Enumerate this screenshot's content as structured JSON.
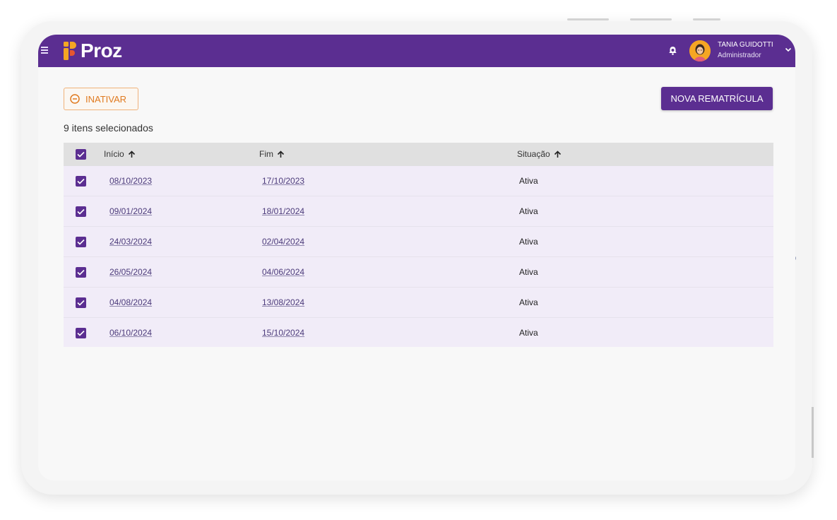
{
  "app": {
    "logo_text": "Proz",
    "brand_color": "#5b2e91",
    "accent_color": "#f5a623"
  },
  "header": {
    "user_name": "TANIA GUIDOTTI",
    "user_role": "Administrador",
    "icons": [
      "menu-icon",
      "bell-icon",
      "avatar",
      "chevron-down-icon"
    ]
  },
  "toolbar": {
    "inativar_label": "INATIVAR",
    "nova_label": "NOVA REMATRÍCULA"
  },
  "selection": {
    "count_text": "9 itens selecionados"
  },
  "table": {
    "columns": [
      {
        "label": "Início",
        "sort": "asc"
      },
      {
        "label": "Fim",
        "sort": "asc"
      },
      {
        "label": "Situação",
        "sort": "asc"
      }
    ],
    "rows": [
      {
        "inicio": "08/10/2023",
        "fim": "17/10/2023",
        "situacao": "Ativa",
        "checked": true
      },
      {
        "inicio": "09/01/2024",
        "fim": "18/01/2024",
        "situacao": "Ativa",
        "checked": true
      },
      {
        "inicio": "24/03/2024",
        "fim": "02/04/2024",
        "situacao": "Ativa",
        "checked": true
      },
      {
        "inicio": "26/05/2024",
        "fim": "04/06/2024",
        "situacao": "Ativa",
        "checked": true
      },
      {
        "inicio": "04/08/2024",
        "fim": "13/08/2024",
        "situacao": "Ativa",
        "checked": true
      },
      {
        "inicio": "06/10/2024",
        "fim": "15/10/2024",
        "situacao": "Ativa",
        "checked": true
      }
    ]
  }
}
